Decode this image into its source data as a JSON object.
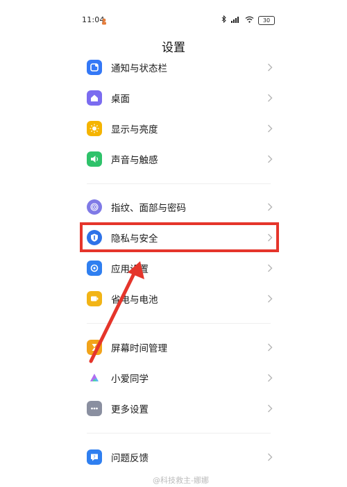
{
  "status_bar": {
    "time": "11:04",
    "battery": "30",
    "icons": [
      "bluetooth-icon",
      "signal-icon",
      "wifi-icon",
      "battery-icon"
    ]
  },
  "title": "设置",
  "groups": [
    {
      "items": [
        {
          "label": "通知与状态栏",
          "icon": "notification-icon",
          "color": "#3478f6"
        },
        {
          "label": "桌面",
          "icon": "home-icon",
          "color": "#7b6cf0"
        },
        {
          "label": "显示与亮度",
          "icon": "sun-icon",
          "color": "#f5b400"
        },
        {
          "label": "声音与触感",
          "icon": "speaker-icon",
          "color": "#2ec26a"
        }
      ]
    },
    {
      "items": [
        {
          "label": "指纹、面部与密码",
          "icon": "fingerprint-icon",
          "color": "#7f7ae6"
        },
        {
          "label": "隐私与安全",
          "icon": "shield-icon",
          "color": "#2f73e8"
        },
        {
          "label": "应用设置",
          "icon": "app-settings-icon",
          "color": "#2f7ff0"
        },
        {
          "label": "省电与电池",
          "icon": "battery-saver-icon",
          "color": "#f2b416"
        }
      ]
    },
    {
      "items": [
        {
          "label": "屏幕时间管理",
          "icon": "hourglass-icon",
          "color": "#f2a31a"
        },
        {
          "label": "小爱同学",
          "icon": "xiaoai-icon",
          "color": "#ffffff"
        },
        {
          "label": "更多设置",
          "icon": "more-icon",
          "color": "#8a8fa0"
        }
      ]
    },
    {
      "items": [
        {
          "label": "问题反馈",
          "icon": "feedback-icon",
          "color": "#2f7ff0"
        }
      ]
    }
  ],
  "highlight_color": "#e5352b",
  "watermark": "@科技救主-娜娜"
}
